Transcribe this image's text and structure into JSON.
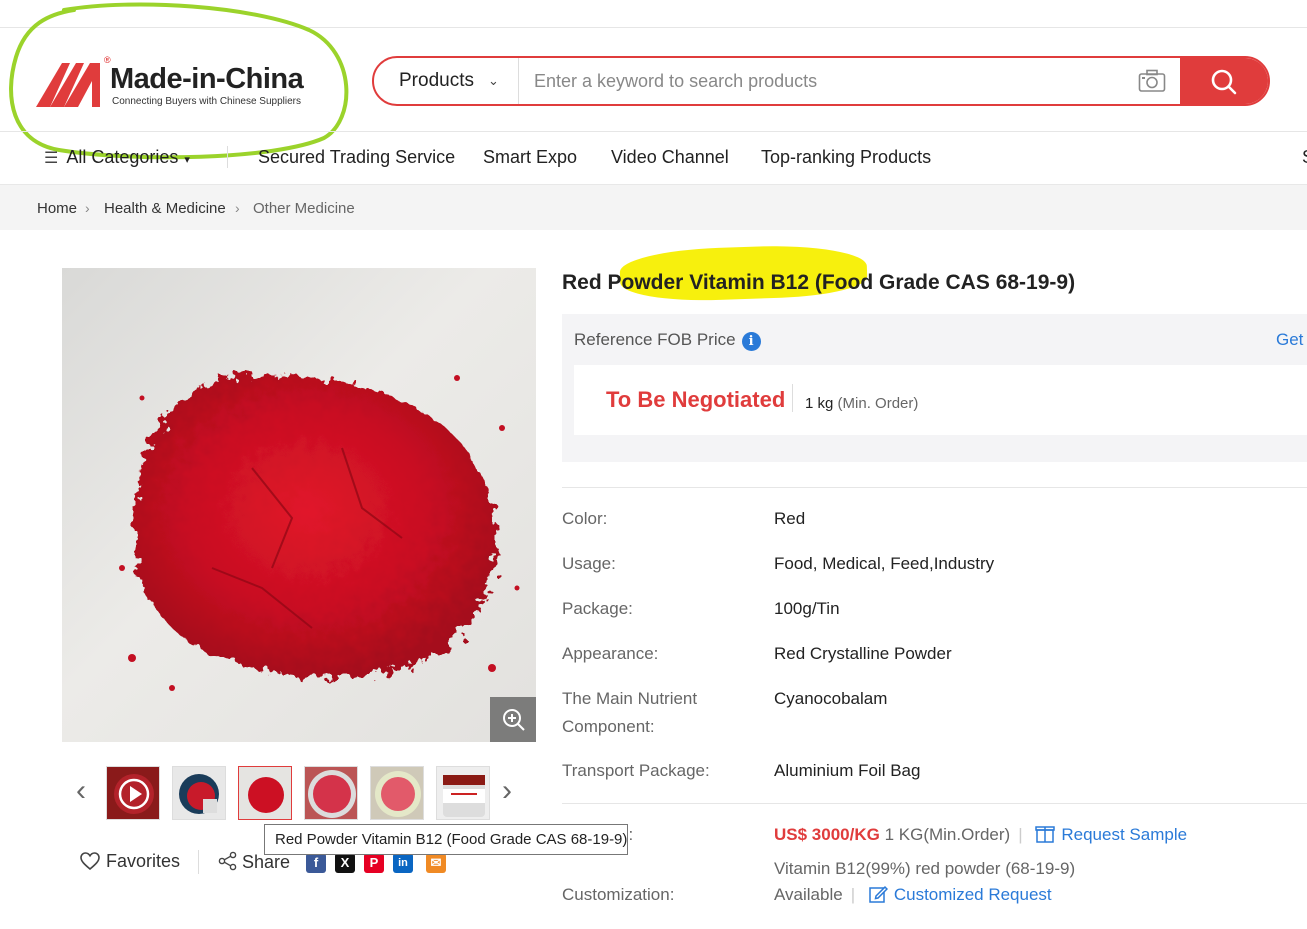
{
  "header": {
    "brand": "Made-in-China",
    "reg_mark": "®",
    "tagline": "Connecting Buyers with Chinese Suppliers",
    "search_category": "Products",
    "search_placeholder": "Enter a keyword to search products"
  },
  "nav": {
    "all_categories": "All Categories",
    "items": [
      "Secured Trading Service",
      "Smart Expo",
      "Video Channel",
      "Top-ranking Products",
      "S"
    ]
  },
  "breadcrumb": [
    "Home",
    "Health & Medicine",
    "Other Medicine"
  ],
  "product": {
    "title": "Red Powder Vitamin B12 (Food Grade CAS 68-19-9)",
    "ref_price_label": "Reference FOB Price",
    "get_label": "Get",
    "price_text": "To Be Negotiated",
    "moq_value": "1 kg",
    "moq_note": "(Min. Order)",
    "specs": [
      {
        "label": "Color:",
        "value": "Red"
      },
      {
        "label": "Usage:",
        "value": "Food, Medical, Feed,Industry"
      },
      {
        "label": "Package:",
        "value": "100g/Tin"
      },
      {
        "label": "Appearance:",
        "value": "Red Crystalline Powder"
      },
      {
        "label": "The Main Nutrient Component:",
        "value": "Cyanocobalam"
      },
      {
        "label": "Transport Package:",
        "value": "Aluminium Foil Bag"
      }
    ],
    "sample_label_tail": "s:",
    "sample_price": "US$ 3000/KG",
    "sample_min": "1 KG(Min.Order)",
    "request_sample": "Request Sample",
    "sample_desc": "Vitamin B12(99%) red powder (68-19-9)",
    "customization_label": "Customization:",
    "customization_value": "Available",
    "customized_request": "Customized Request"
  },
  "gallery": {
    "tooltip": "Red Powder Vitamin B12 (Food Grade CAS 68-19-9)",
    "favorites": "Favorites",
    "share": "Share"
  },
  "colors": {
    "accent": "#e03c3c",
    "link": "#2a7ad8",
    "annotation_circle": "#9bd32b",
    "highlight": "#f7ef00"
  }
}
